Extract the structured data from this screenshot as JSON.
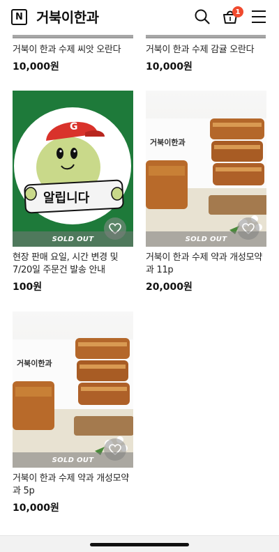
{
  "header": {
    "logo_letter": "N",
    "store_name": "거북이한과",
    "cart_count": "1"
  },
  "partial_row": [
    {
      "name": "거북이 한과 수제 씨앗 오란다",
      "price": "10,000원"
    },
    {
      "name": "거북이 한과 수제 감귤 오란다",
      "price": "10,000원"
    }
  ],
  "products": [
    {
      "name": "현장 판매 요일, 시간 변경 및 7/20일 주문건 발송 안내",
      "price": "100원",
      "badge": "SOLD OUT",
      "image": "notice-mascot",
      "mascot_text": "알립니다",
      "cap_letter": "G"
    },
    {
      "name": "거북이 한과 수제 약과 개성모약과 11p",
      "price": "20,000원",
      "badge": "SOLD OUT",
      "image": "yakgwa-photo",
      "box_text": "거북이한과"
    },
    {
      "name": "거북이 한과 수제 약과 개성모약과 5p",
      "price": "10,000원",
      "badge": "SOLD OUT",
      "image": "yakgwa-photo",
      "box_text": "거북이한과"
    }
  ],
  "colors": {
    "badge_red": "#f04a2e",
    "notice_green": "#1e7a3a"
  }
}
